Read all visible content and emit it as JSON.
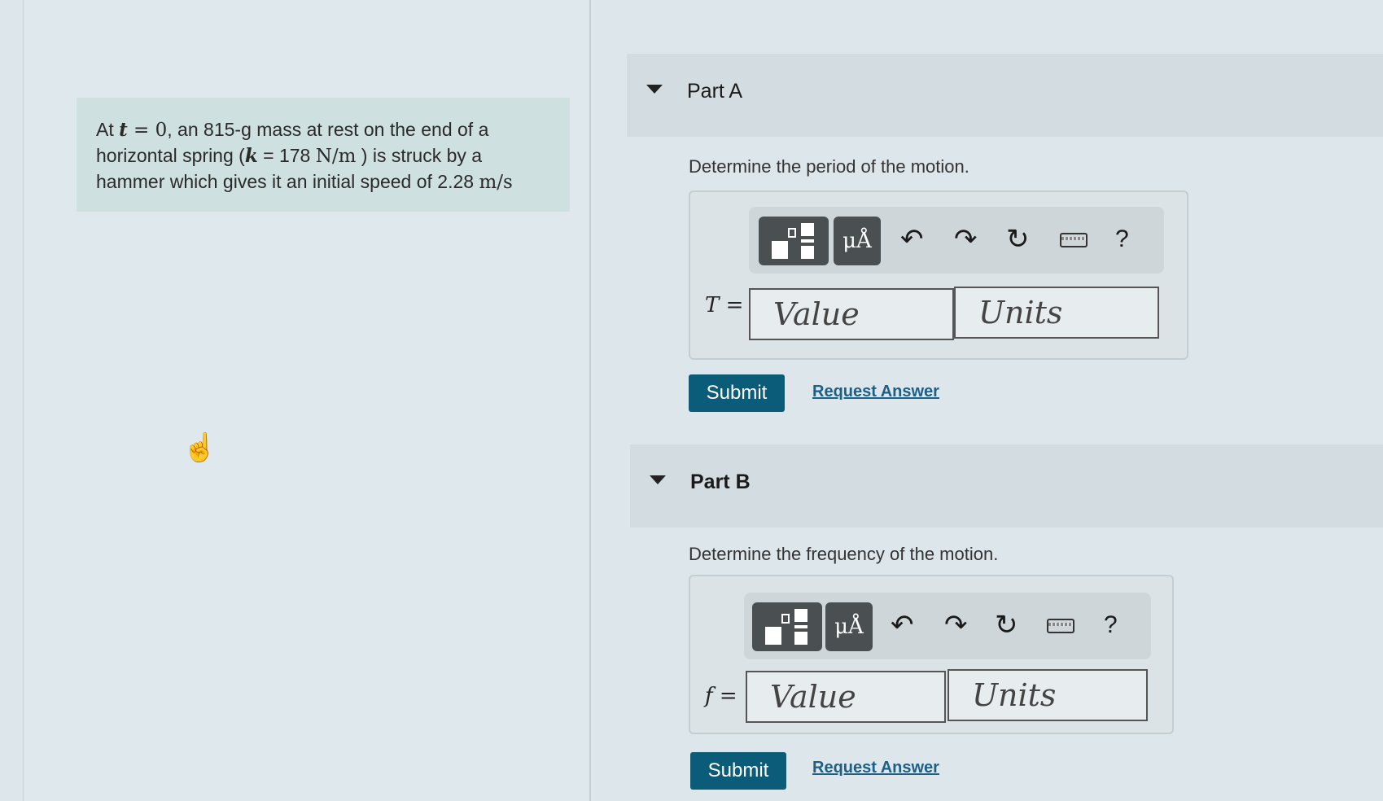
{
  "problem": {
    "text_1": "At ",
    "var_t": "t",
    "eq_1": " = 0",
    "text_2": ", an 815-g mass at rest on the end of a horizontal spring (",
    "var_k": "k",
    "eq_2": " = 178 ",
    "unit_1": "N/m",
    "text_3": " ) is struck by a hammer which gives it an initial speed of 2.28 ",
    "unit_2": "m/s"
  },
  "part_a": {
    "title": "Part A",
    "question": "Determine the period of the motion.",
    "variable": "T =",
    "value_placeholder": "Value",
    "units_placeholder": "Units",
    "submit_label": "Submit",
    "request_label": "Request Answer"
  },
  "part_b": {
    "title": "Part B",
    "question": "Determine the frequency of the motion.",
    "variable": "f =",
    "value_placeholder": "Value",
    "units_placeholder": "Units",
    "submit_label": "Submit",
    "request_label": "Request Answer"
  },
  "toolbar": {
    "mu_label": "μÅ",
    "help_label": "?",
    "undo_icon": "undo-icon",
    "redo_icon": "redo-icon",
    "reset_icon": "reset-icon",
    "keyboard_icon": "keyboard-icon"
  },
  "colors": {
    "submit_bg": "#0b5c78",
    "link": "#1e5f86",
    "problem_bg": "#cfe0e1"
  }
}
